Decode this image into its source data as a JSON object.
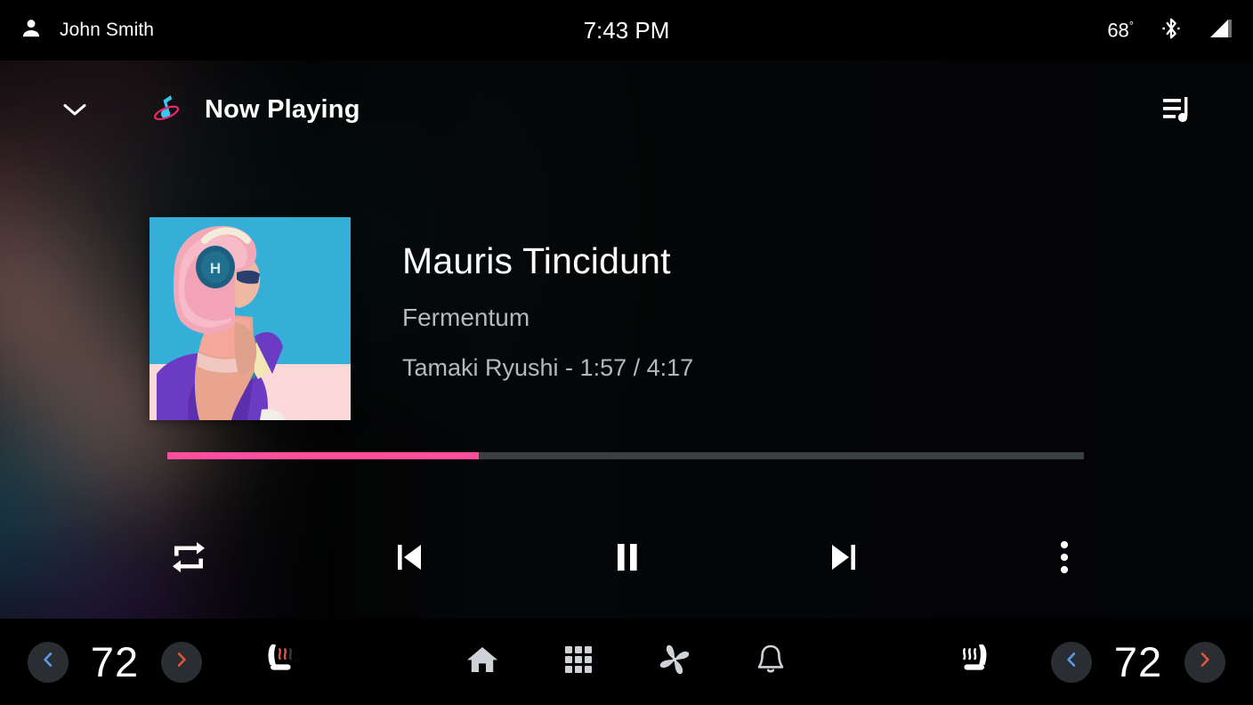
{
  "statusbar": {
    "user_icon": "person-icon",
    "user_name": "John Smith",
    "time": "7:43 PM",
    "temperature": "68",
    "degree": "°",
    "bluetooth_icon": "bluetooth-icon",
    "signal_icon": "signal-bars-icon"
  },
  "media": {
    "collapse_icon": "chevron-down-icon",
    "app_icon": "music-note-orbit-icon",
    "header_title": "Now Playing",
    "queue_icon": "playlist-queue-icon",
    "album_art_alt": "person-with-pink-hair-wearing-headphones",
    "track_title": "Mauris Tincidunt",
    "album": "Fermentum",
    "artist_time": "Tamaki Ryushi - 1:57 / 4:17",
    "artist": "Tamaki Ryushi",
    "elapsed": "1:57",
    "duration": "4:17",
    "progress_percent": 34,
    "progress_color": "#fb4e9d",
    "progress_track_color": "#3a4042",
    "controls": [
      {
        "name": "repeat-button",
        "icon": "repeat-icon"
      },
      {
        "name": "skip-previous-button",
        "icon": "skip-previous-icon"
      },
      {
        "name": "pause-button",
        "icon": "pause-icon"
      },
      {
        "name": "skip-next-button",
        "icon": "skip-next-icon"
      },
      {
        "name": "more-options-button",
        "icon": "more-vertical-icon"
      }
    ]
  },
  "navbar": {
    "left_climate": {
      "decrease_icon": "chevron-left-icon",
      "temperature": "72",
      "increase_icon": "chevron-right-icon",
      "seat_heater_icon": "heated-seat-icon"
    },
    "right_climate": {
      "decrease_icon": "chevron-left-icon",
      "temperature": "72",
      "increase_icon": "chevron-right-icon",
      "seat_heater_icon": "heated-seat-icon"
    },
    "center_items": [
      {
        "name": "home-button",
        "icon": "home-icon"
      },
      {
        "name": "apps-button",
        "icon": "apps-grid-icon"
      },
      {
        "name": "climate-button",
        "icon": "fan-icon"
      },
      {
        "name": "notifications-button",
        "icon": "bell-icon"
      }
    ]
  },
  "colors": {
    "accent_pink": "#fb4e9d",
    "accent_blue": "#5b9be8",
    "accent_red": "#e2563c",
    "icon_gray": "#cfd3d8",
    "text_secondary": "#b6b9bb",
    "circle_bg": "#2a2d31"
  }
}
